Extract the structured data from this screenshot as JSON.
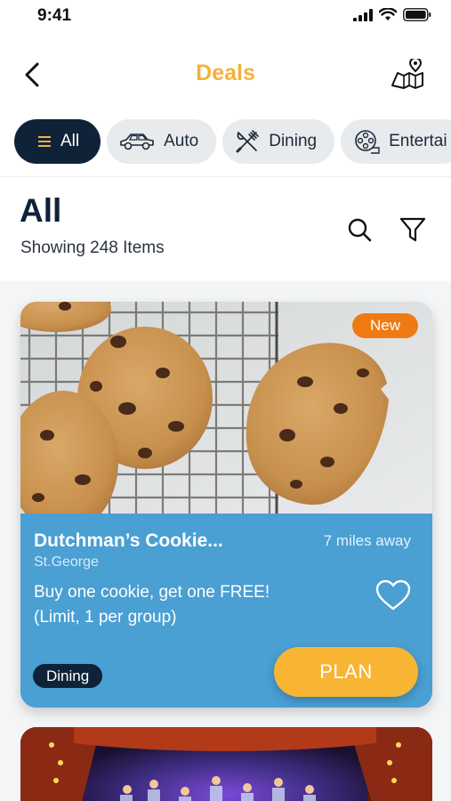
{
  "status_bar": {
    "time": "9:41"
  },
  "header": {
    "title": "Deals",
    "back_icon": "chevron-left-icon",
    "map_icon": "map-pin-icon"
  },
  "categories": [
    {
      "label": "All",
      "icon": "list-icon",
      "active": true
    },
    {
      "label": "Auto",
      "icon": "car-icon",
      "active": false
    },
    {
      "label": "Dining",
      "icon": "fork-knife-icon",
      "active": false
    },
    {
      "label": "Entertai",
      "icon": "film-reel-icon",
      "active": false
    }
  ],
  "section": {
    "title": "All",
    "count_text": "Showing 248 Items"
  },
  "deals": [
    {
      "badge": "New",
      "title": "Dutchman’s Cookie...",
      "location": "St.George",
      "distance": "7 miles away",
      "description_lines": [
        "Buy one cookie, get one FREE!",
        "(Limit, 1 per group)"
      ],
      "category": "Dining",
      "action": "PLAN",
      "image": "cookies-photo"
    },
    {
      "image": "theater-stage-photo"
    }
  ],
  "colors": {
    "accent": "#f3b23a",
    "navy": "#0f2238",
    "card_blue": "#4a9fd3",
    "badge_orange": "#f07a12",
    "plan_yellow": "#f8b534"
  }
}
